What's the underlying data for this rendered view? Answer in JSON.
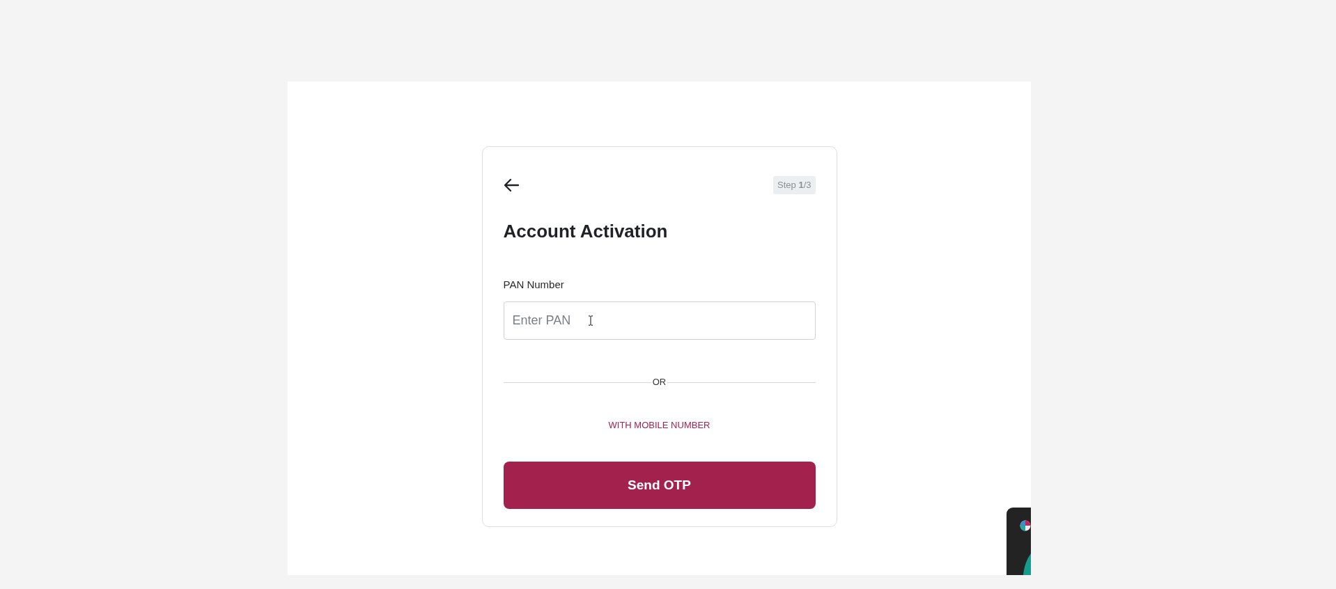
{
  "step_badge": "Step **1**/3",
  "title": "Account Activation",
  "pan_field": {
    "label": "PAN Number",
    "placeholder": "Enter PAN"
  },
  "divider": {
    "label": "OR"
  },
  "alt_link": "WITH MOBILE NUMBER",
  "submit_button": "Send OTP"
}
